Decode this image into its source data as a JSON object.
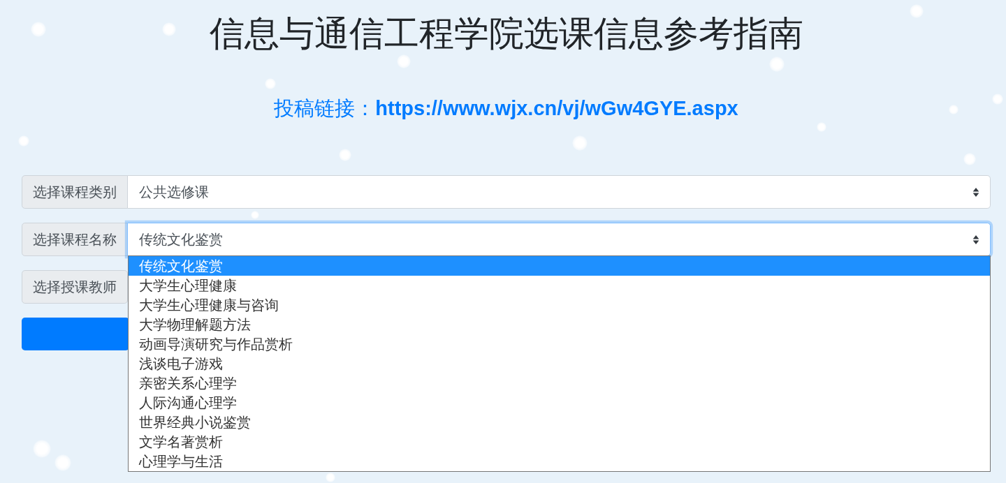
{
  "page": {
    "title": "信息与通信工程学院选课信息参考指南",
    "submission_link": "投稿链接：**https://www.wjx.cn/vj/wGw4GYE.aspx**"
  },
  "form": {
    "rows": [
      {
        "label": "选择课程类别",
        "value": "公共选修课",
        "focused": false,
        "expanded": false
      },
      {
        "label": "选择课程名称",
        "value": "传统文化鉴赏",
        "focused": true,
        "expanded": true,
        "options": [
          {
            "label": "传统文化鉴赏",
            "selected": true
          },
          {
            "label": "大学生心理健康",
            "selected": false
          },
          {
            "label": "大学生心理健康与咨询",
            "selected": false
          },
          {
            "label": "大学物理解题方法",
            "selected": false
          },
          {
            "label": "动画导演研究与作品赏析",
            "selected": false
          },
          {
            "label": "浅谈电子游戏",
            "selected": false
          },
          {
            "label": "亲密关系心理学",
            "selected": false
          },
          {
            "label": "人际沟通心理学",
            "selected": false
          },
          {
            "label": "世界经典小说鉴赏",
            "selected": false
          },
          {
            "label": "文学名著赏析",
            "selected": false
          },
          {
            "label": "心理学与生活",
            "selected": false
          }
        ]
      },
      {
        "label": "选择授课教师"
      }
    ]
  }
}
